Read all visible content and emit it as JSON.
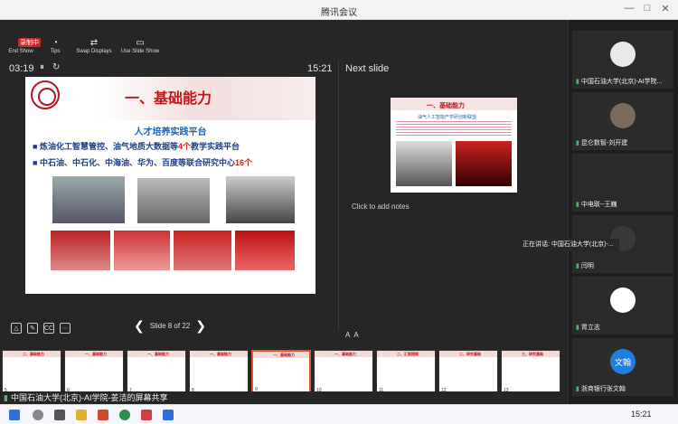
{
  "window": {
    "title": "腾讯会议",
    "controls": [
      "—",
      "□",
      "✕"
    ]
  },
  "presenter": {
    "toolbar": [
      {
        "icon": "end-show-icon",
        "glyph": "◖",
        "label": "End Show"
      },
      {
        "icon": "tips-icon",
        "glyph": "◔",
        "label": "Tips"
      },
      {
        "icon": "swap-displays-icon",
        "glyph": "⇄",
        "label": "Swap Displays"
      },
      {
        "icon": "use-slide-show-icon",
        "glyph": "▭",
        "label": "Use Slide Show"
      }
    ],
    "record_label": "录制中",
    "elapsed": "03:19",
    "pause_glyph": "⏸",
    "restart_glyph": "↻",
    "clock": "15:21",
    "next_slide_label": "Next slide",
    "notes_placeholder": "Click to add notes",
    "slide_counter": "Slide 8 of 22",
    "prev_glyph": "❮",
    "next_glyph": "❯",
    "font_controls": [
      "A",
      "A"
    ]
  },
  "current_slide": {
    "title": "一、基础能力",
    "subtitle": "人才培养实践平台",
    "bullet1_pre": "炼油化工智慧管控、油气地质大数据等",
    "bullet1_hl": "4个",
    "bullet1_post": "教学实践平台",
    "bullet2_pre": "中石油、中石化、中海油、华为、百度等联合研究中心",
    "bullet2_hl": "16个"
  },
  "next_slide": {
    "title": "一、基础能力",
    "subtitle": "油气人工智能产学研创新联盟"
  },
  "filmstrip": [
    {
      "num": "5",
      "title": "二、基础能力"
    },
    {
      "num": "6",
      "title": "一、基础能力"
    },
    {
      "num": "7",
      "title": "一、基础能力"
    },
    {
      "num": "8",
      "title": "一、基础能力"
    },
    {
      "num": "9",
      "title": "一、基础能力"
    },
    {
      "num": "10",
      "title": "一、基础能力"
    },
    {
      "num": "11",
      "title": "二、汇报提纲"
    },
    {
      "num": "12",
      "title": "二、研究基础"
    },
    {
      "num": "13",
      "title": "三、研究基础"
    }
  ],
  "share_banner": "中国石油大学(北京)-AI学院-姜洁的屏幕共享",
  "participants": [
    {
      "name": "中国石油大学(北京)-AI学院...",
      "avatar_color": "#e9e9e9"
    },
    {
      "name": "昆仑数智-刘开建",
      "avatar_color": "#7a6a5a"
    },
    {
      "name": "中电联--王巍",
      "avatar_color": "#2b2b2b"
    },
    {
      "name": "闫明",
      "avatar_color": "#3a3a3a"
    },
    {
      "name": "胃立志",
      "avatar_color": "#ffffff"
    },
    {
      "name": "浙商银行张文翰",
      "avatar_color": "#1f7fe0",
      "initials": "文翰"
    }
  ],
  "speaking_label": "正在讲话: 中国石油大学(北京)-...",
  "taskbar": {
    "time": "15:21"
  }
}
